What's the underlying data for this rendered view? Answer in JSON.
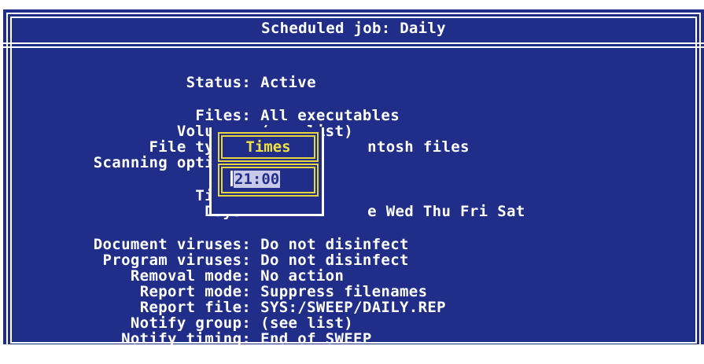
{
  "window": {
    "title": "Scheduled job: Daily"
  },
  "fields": [
    {
      "label": "Status:",
      "value": "Active"
    },
    {
      "label": "Files:",
      "value": "All executables"
    },
    {
      "label": "Volumes:",
      "value": "(see list)"
    },
    {
      "label": "File types:",
      "value": "ntosh files"
    },
    {
      "label": "Scanning options:",
      "value": ""
    },
    {
      "label": "Times:",
      "value": ""
    },
    {
      "label": "Days:",
      "value": "e Wed Thu Fri Sat"
    },
    {
      "label": "Document viruses:",
      "value": "Do not disinfect"
    },
    {
      "label": "Program viruses:",
      "value": "Do not disinfect"
    },
    {
      "label": "Removal mode:",
      "value": "No action"
    },
    {
      "label": "Report mode:",
      "value": "Suppress filenames"
    },
    {
      "label": "Report file:",
      "value": "SYS:/SWEEP/DAILY.REP"
    },
    {
      "label": "Notify group:",
      "value": "(see list)"
    },
    {
      "label": "Notify timing:",
      "value": "End of SWEEP"
    }
  ],
  "popup": {
    "title": "Times",
    "input_value": "21:00"
  },
  "colors": {
    "background": "#202e8a",
    "text": "#ffffff",
    "popup_border": "#e5d43a",
    "popup_title": "#f0e040"
  }
}
